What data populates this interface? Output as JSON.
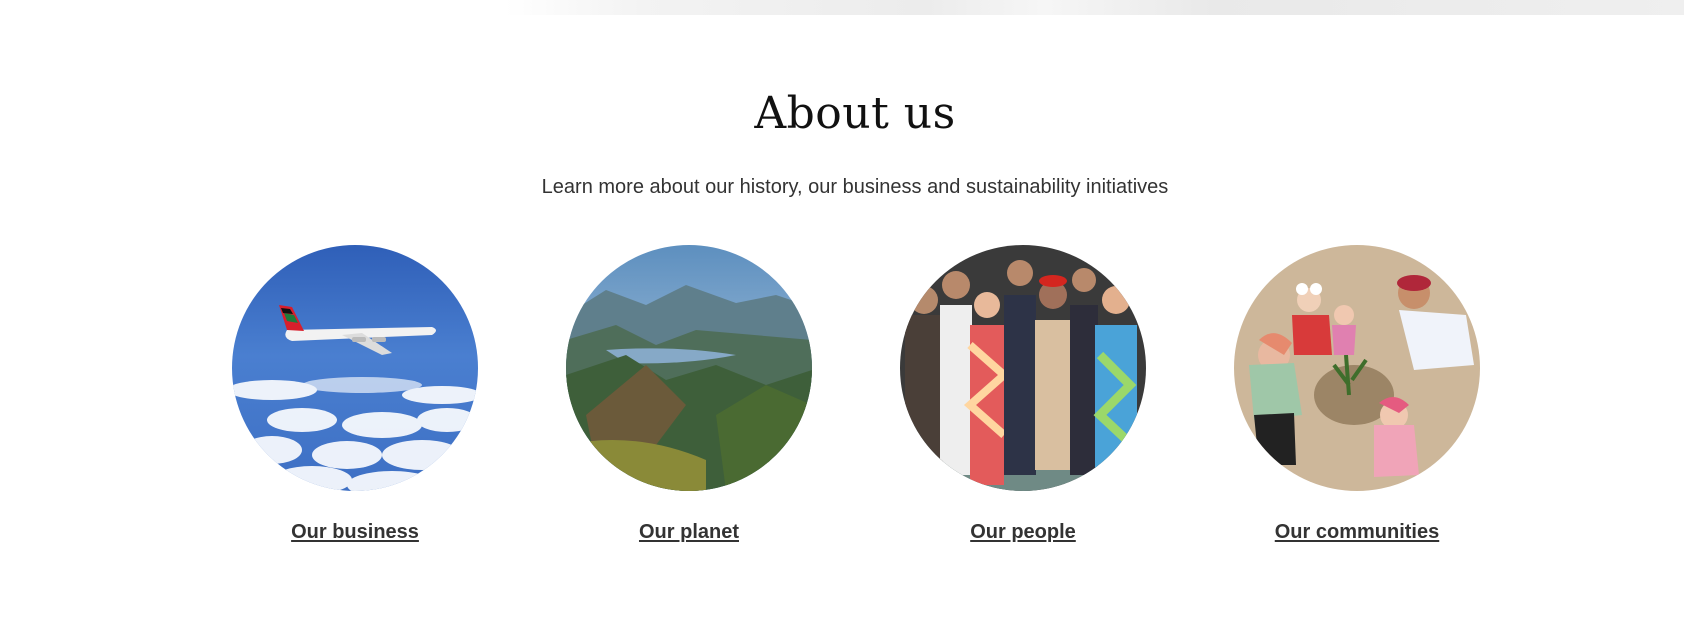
{
  "about": {
    "title": "About us",
    "subtitle": "Learn more about our history, our business and sustainability initiatives"
  },
  "cards": [
    {
      "label": "Our business",
      "icon": "airplane-sky-image"
    },
    {
      "label": "Our planet",
      "icon": "mountain-landscape-image"
    },
    {
      "label": "Our people",
      "icon": "crew-group-image"
    },
    {
      "label": "Our communities",
      "icon": "planting-community-image"
    }
  ],
  "colors": {
    "text": "#333333",
    "title": "#111111",
    "sky": "#3f73c7"
  }
}
